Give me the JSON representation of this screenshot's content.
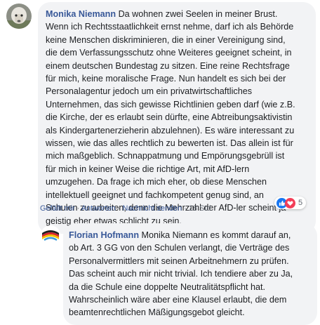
{
  "comment": {
    "author": "Monika Niemann",
    "text": " Da wohnen zwei Seelen in meiner Brust.\nWenn ich Rechtsstaatlichkeit ernst nehme, darf ich als Behörde\nkeine Menschen diskriminieren, die in einer Vereinigung sind,\ndie dem Verfassungsschutz ohne Weiteres geeignet scheint, in\neinem deutschen Bundestag zu sitzen. Eine reine Rechtsfrage\nfür mich, keine moralische Frage. Nun handelt es sich bei der\nPersonalagentur jedoch um ein privatwirtschaftliches\nUnternehmen, das sich gewisse Richtlinien geben darf (wie z.B.\ndie Kirche, der es erlaubt sein dürfte, eine Abtreibungsaktivistin\nals Kindergartenerzieherin abzulehnen). Es wäre interessant zu\nwissen, wie das alles rechtlich zu bewerten ist. Das allein ist für\nmich maßgeblich. Schnappatmung und Empörungsgebrüll ist\nfür mich in keiner Weise die richtige Art, mit AfD-lern\numzugehen. Da frage ich mich eher, ob diese Menschen\nintellektuell geeignet und fachkompetent genug sind, an\nSchulen zu arbeiten, denn die Mehrzahl der AfD-ler scheint ja\ngeistig eher etwas schlicht zu sein.",
    "actions": {
      "like": "Gefällt mir",
      "reply": "Antworten",
      "message": "Nachricht senden",
      "time": "18 Std."
    },
    "reactions": {
      "count": "5",
      "types": [
        "like-icon",
        "love-icon"
      ],
      "like_color": "#1877f2",
      "love_color": "#f33e58"
    }
  },
  "reply": {
    "author": "Florian Hofmann",
    "text": " Monika Niemann es kommt darauf an,\nob Art. 3 GG von den Schulen verlangt, die Verträge des\nPersonalvermittlers mit seinen Arbeitnehmern zu prüfen.\nDas scheint auch mir nicht trivial. Ich tendiere aber zu Ja,\nda die Schule eine doppelte Neutralitätspflicht hat.\nWahrscheinlich wäre aber eine Klausel erlaubt, die dem\nbeamtenrechtlichen Mäßigungsgebot gleicht."
  },
  "colors": {
    "bubble": "#f2f3f5",
    "author": "#385898",
    "meta": "#606770"
  }
}
